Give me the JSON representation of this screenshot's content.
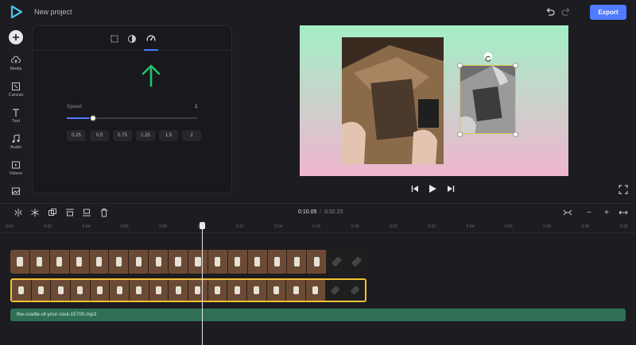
{
  "header": {
    "project_title": "New project",
    "export_label": "Export"
  },
  "sidebar": {
    "items": [
      {
        "label": "Media",
        "icon": "cloud-upload-icon"
      },
      {
        "label": "Canvas",
        "icon": "canvas-icon"
      },
      {
        "label": "Text",
        "icon": "text-icon"
      },
      {
        "label": "Audio",
        "icon": "music-note-icon"
      },
      {
        "label": "Videos",
        "icon": "video-icon"
      },
      {
        "label": "",
        "icon": "image-icon"
      }
    ]
  },
  "panel": {
    "tabs": [
      {
        "icon": "crop-icon"
      },
      {
        "icon": "contrast-icon"
      },
      {
        "icon": "speedometer-icon",
        "active": true
      }
    ],
    "speed_label": "Speed",
    "speed_value": "1",
    "speed_fraction": 0.2,
    "presets": [
      "0.25",
      "0.5",
      "0.75",
      "1.25",
      "1.5",
      "2"
    ]
  },
  "timeline": {
    "current_time": "0:10.05",
    "separator": "/",
    "total_time": "0:32.23",
    "ruler_ticks": [
      "0:00",
      "0:02",
      "0:04",
      "0:06",
      "0:08",
      "0:10",
      "0:12",
      "0:14",
      "0:16",
      "0:18",
      "0:20",
      "0:22",
      "0:24",
      "0:26",
      "0:28",
      "0:30",
      "0:32"
    ],
    "audio_track_label": "the-cradle-of-your-soul-15700.mp3",
    "zoom_out": "−",
    "zoom_in": "+"
  },
  "colors": {
    "accent": "#4e7bff",
    "selection": "#f1c232",
    "audio": "#2f6f55",
    "arrow": "#1fc36b"
  }
}
